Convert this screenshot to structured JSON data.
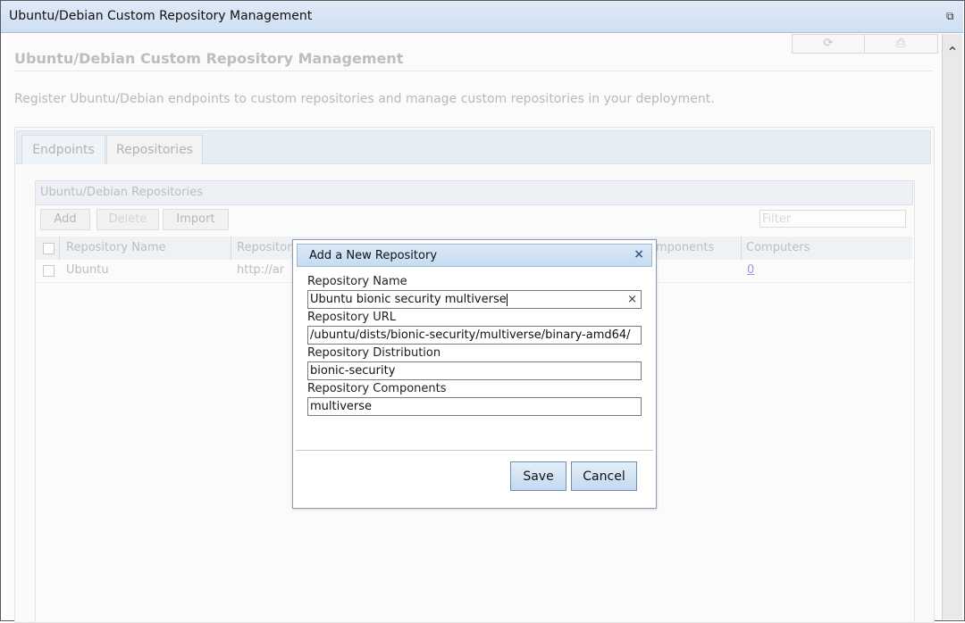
{
  "window": {
    "title": "Ubuntu/Debian Custom Repository Management",
    "popout_icon": "popout-icon"
  },
  "toolbar": {
    "refresh_icon": "refresh-icon",
    "print_icon": "print-icon"
  },
  "page": {
    "title": "Ubuntu/Debian Custom Repository Management",
    "description": "Register Ubuntu/Debian endpoints to custom repositories and manage custom repositories in your deployment."
  },
  "tabs": [
    {
      "label": "Endpoints"
    },
    {
      "label": "Repositories"
    }
  ],
  "grid": {
    "title": "Ubuntu/Debian Repositories",
    "buttons": {
      "add": "Add",
      "delete": "Delete",
      "import": "Import"
    },
    "filter_placeholder": "Filter",
    "columns": [
      "Repository Name",
      "Repositor",
      "mponents",
      "Computers"
    ],
    "rows": [
      {
        "name": "Ubuntu",
        "url": "http://ar",
        "computers": "0"
      }
    ]
  },
  "dialog": {
    "title": "Add a New Repository",
    "fields": {
      "name": {
        "label": "Repository Name",
        "value": "Ubuntu bionic security multiverse"
      },
      "url": {
        "label": "Repository URL",
        "value": "/ubuntu/dists/bionic-security/multiverse/binary-amd64/"
      },
      "distribution": {
        "label": "Repository Distribution",
        "value": "bionic-security"
      },
      "components": {
        "label": "Repository Components",
        "value": "multiverse"
      }
    },
    "save_label": "Save",
    "cancel_label": "Cancel"
  },
  "colors": {
    "dialog_header": "#c6dcf2",
    "button_border": "#6e8fb5",
    "link": "#9b9bd9"
  }
}
